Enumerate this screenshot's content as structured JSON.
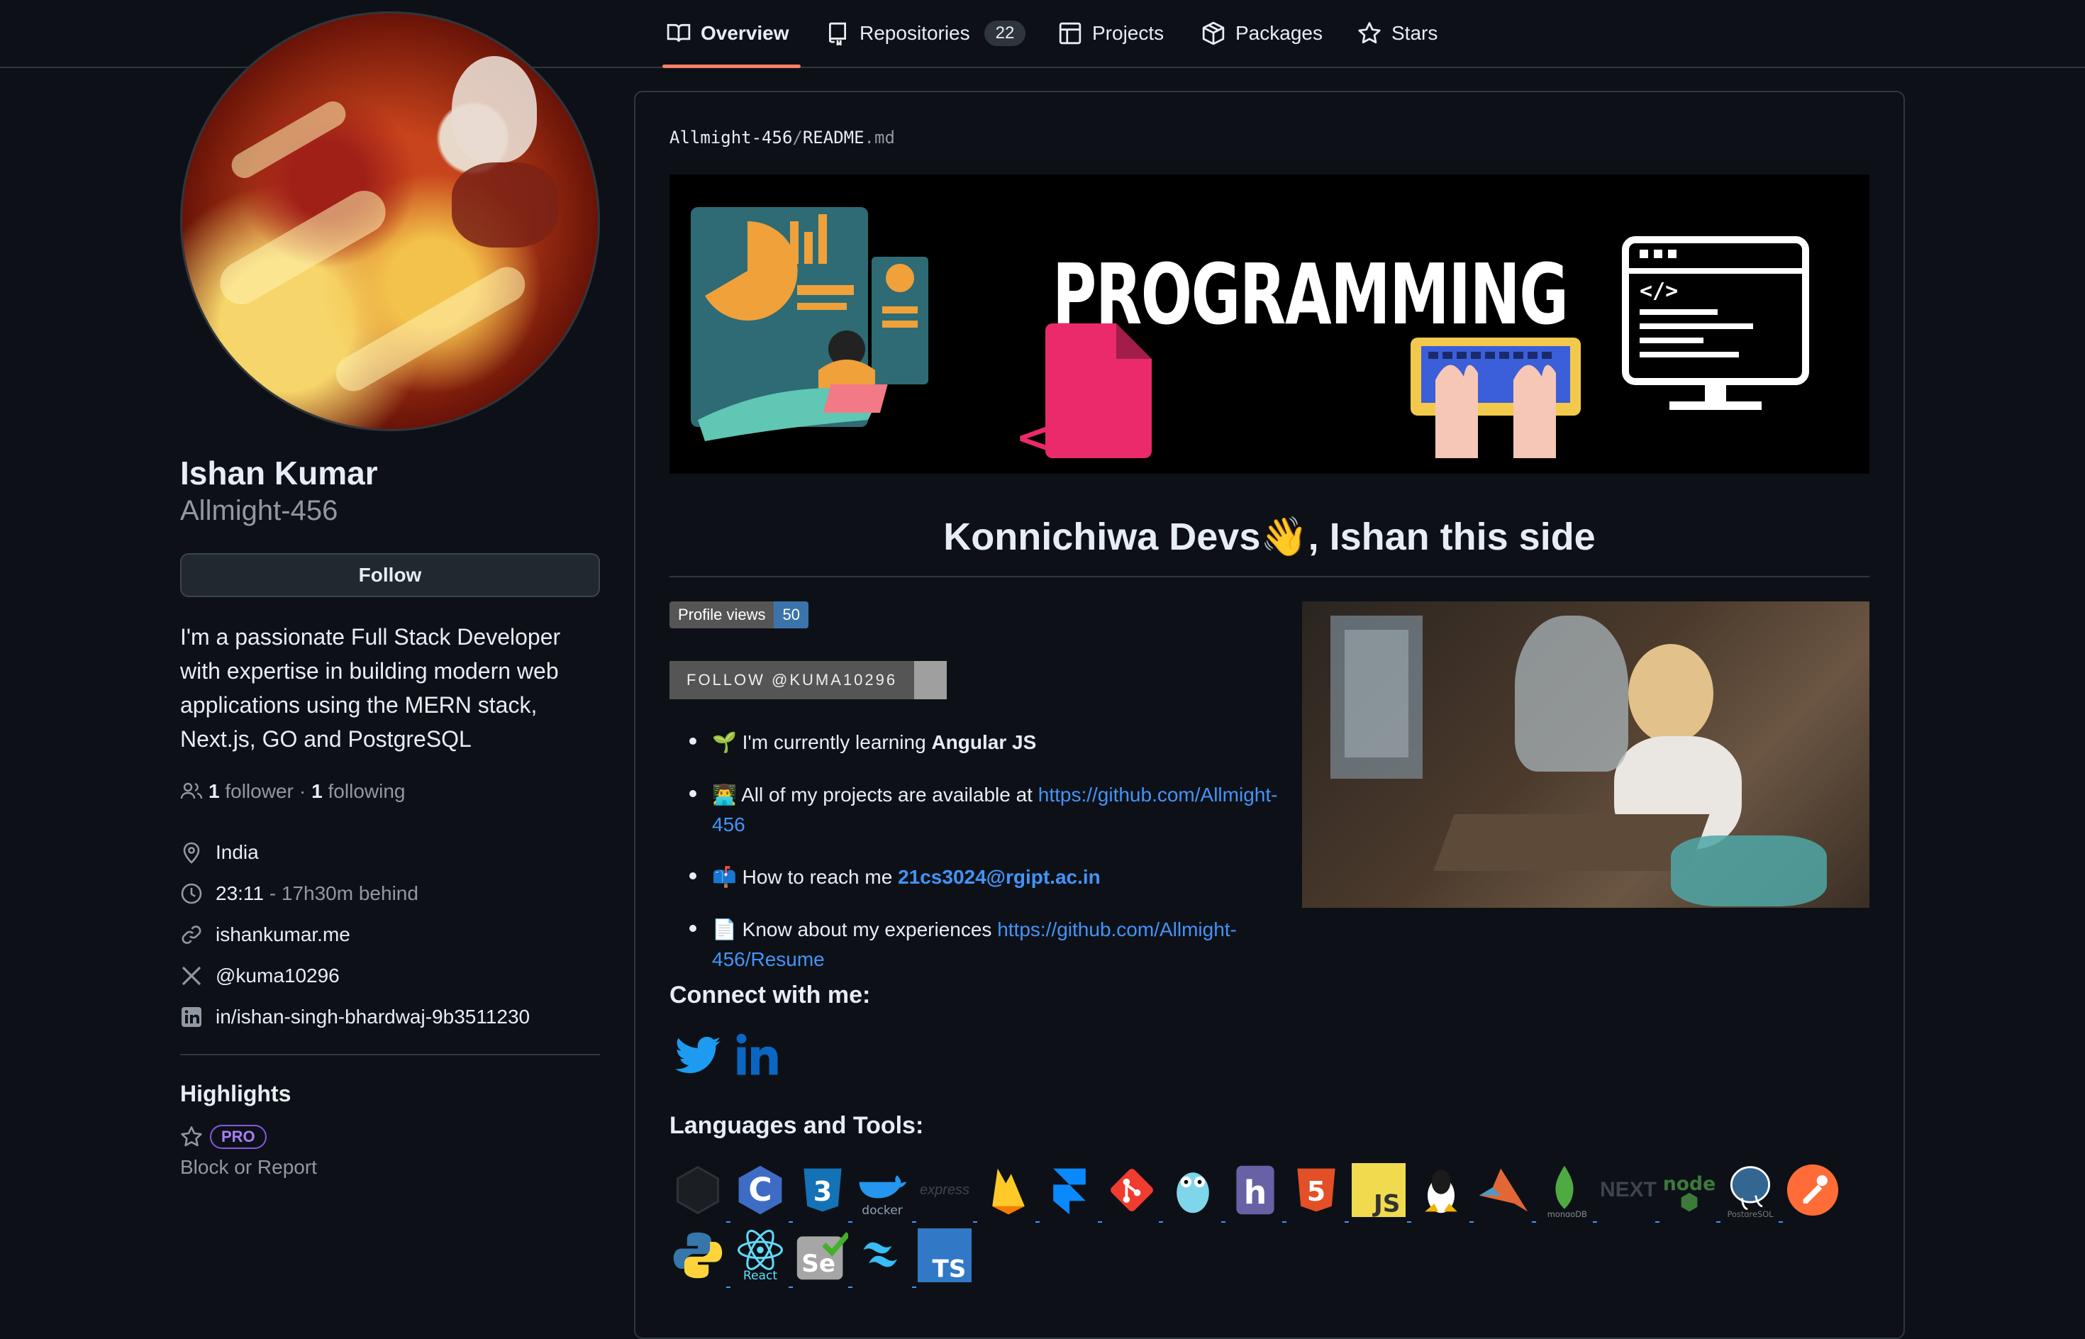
{
  "nav": {
    "tabs": [
      {
        "label": "Overview",
        "icon": "book-icon",
        "active": true
      },
      {
        "label": "Repositories",
        "icon": "repo-icon",
        "count": "22"
      },
      {
        "label": "Projects",
        "icon": "project-table-icon"
      },
      {
        "label": "Packages",
        "icon": "package-icon"
      },
      {
        "label": "Stars",
        "icon": "star-icon"
      }
    ]
  },
  "profile": {
    "full_name": "Ishan Kumar",
    "login": "Allmight-456",
    "follow_label": "Follow",
    "bio": "I'm a passionate Full Stack Developer with expertise in building modern web applications using the MERN stack, Next.js, GO and PostgreSQL",
    "followers_count": "1",
    "followers_label": "follower",
    "separator": "·",
    "following_count": "1",
    "following_label": "following",
    "location": "India",
    "time": "23:11",
    "time_note": "- 17h30m behind",
    "website": "ishankumar.me",
    "x_handle": "@kuma10296",
    "linkedin": "in/ishan-singh-bhardwaj-9b3511230"
  },
  "highlights": {
    "title": "Highlights",
    "pro_label": "PRO",
    "block_label": "Block or Report"
  },
  "readme": {
    "path_user": "Allmight-456",
    "path_sep": "/",
    "path_file": "README",
    "path_ext": ".md",
    "banner_text": "PROGRAMMING",
    "banner_code_glyph": "</>",
    "greeting": "Konnichiwa Devs👋, Ishan this side",
    "views_label": "Profile views",
    "views_count": "50",
    "follow_badge": "FOLLOW @KUMA10296",
    "bullets": [
      {
        "emoji": "🌱",
        "text": "I'm currently learning ",
        "bold": "Angular JS"
      },
      {
        "emoji": "👨‍💻",
        "text": "All of my projects are available at ",
        "link_1": "https://github.com/Allmight-",
        "link_2": "456"
      },
      {
        "emoji": "📫",
        "text": "How to reach me ",
        "link": "21cs3024@rgipt.ac.in"
      },
      {
        "emoji": "📄",
        "text": "Know about my experiences ",
        "link": "https://github.com/Allmight-456/Resume"
      }
    ],
    "connect_title": "Connect with me:",
    "tools_title": "Languages and Tools:",
    "tools_row1": [
      {
        "name": "aws-icon"
      },
      {
        "name": "c-icon",
        "glyph": "C"
      },
      {
        "name": "css3-icon",
        "glyph": "3"
      },
      {
        "name": "docker-icon",
        "glyph": "docker"
      },
      {
        "name": "express-icon",
        "glyph": "express"
      },
      {
        "name": "firebase-icon"
      },
      {
        "name": "framer-icon"
      },
      {
        "name": "git-icon"
      },
      {
        "name": "go-icon"
      },
      {
        "name": "heroku-icon",
        "glyph": "h"
      },
      {
        "name": "html5-icon",
        "glyph": "5"
      },
      {
        "name": "javascript-icon",
        "glyph": "JS"
      },
      {
        "name": "linux-icon"
      },
      {
        "name": "matlab-icon"
      },
      {
        "name": "mongodb-icon",
        "glyph": "mongoDB"
      },
      {
        "name": "nextjs-icon",
        "glyph": "NEXT"
      },
      {
        "name": "nodejs-icon",
        "glyph": "node"
      },
      {
        "name": "postgresql-icon",
        "glyph": "PostgreSQL"
      },
      {
        "name": "postman-icon"
      }
    ],
    "tools_row2": [
      {
        "name": "python-icon"
      },
      {
        "name": "react-icon",
        "glyph": "React"
      },
      {
        "name": "selenium-icon",
        "glyph": "Se"
      },
      {
        "name": "tailwind-icon"
      },
      {
        "name": "typescript-icon",
        "glyph": "TS"
      }
    ]
  },
  "colors": {
    "background": "#0d1117",
    "accent_tab": "#f78166",
    "link": "#4493f8",
    "pro_purple": "#8957e5"
  }
}
